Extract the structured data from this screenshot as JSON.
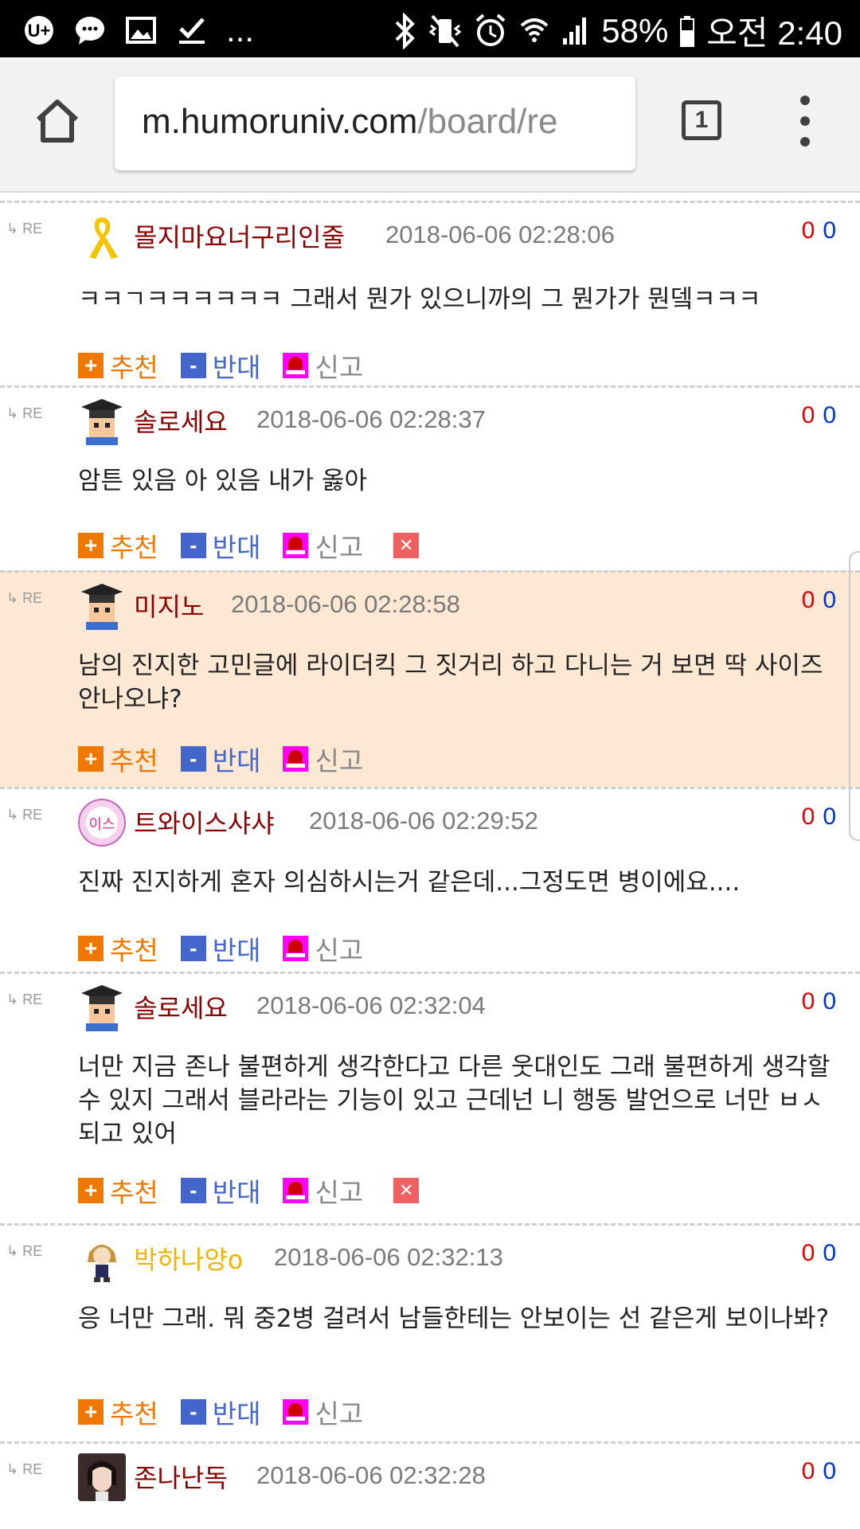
{
  "status_bar": {
    "icons_left": [
      "u-plus-icon",
      "talk-icon",
      "image-icon",
      "check-icon",
      "more-icon"
    ],
    "more_label": "...",
    "battery": "58%",
    "time": "오전 2:40"
  },
  "browser": {
    "url_host": "m.humoruniv.com",
    "url_path": "/board/re",
    "tab_count": "1"
  },
  "labels": {
    "re": "RE",
    "recommend": "추천",
    "oppose": "반대",
    "report": "신고",
    "plus": "+",
    "minus": "-",
    "delete": "✕"
  },
  "comments": [
    {
      "nick": "몰지마요너구리인줄",
      "date": "2018-06-06 02:28:06",
      "up": "0",
      "down": "0",
      "text": "ㅋㅋㄱㅋㅋㅋㅋㅋㅋ 그래서 뭔가 있으니까의 그 뭔가가 뭔뎈ㅋㅋㅋ",
      "avatar": "yellow-ribbon"
    },
    {
      "nick": "솔로세요",
      "date": "2018-06-06 02:28:37",
      "up": "0",
      "down": "0",
      "text": "암튼 있음 아 있음 내가 옳아",
      "avatar": "graduate",
      "deletable": true
    },
    {
      "nick": "미지노",
      "date": "2018-06-06 02:28:58",
      "up": "0",
      "down": "0",
      "text": "남의 진지한 고민글에 라이더킥 그 짓거리 하고 다니는 거 보면 딱 사이즈 안나오냐?",
      "avatar": "graduate",
      "highlighted": true
    },
    {
      "nick": "트와이스샤샤",
      "date": "2018-06-06 02:29:52",
      "up": "0",
      "down": "0",
      "text": "진짜 진지하게 혼자 의심하시는거 같은데...그정도면 병이에요....",
      "avatar": "twice"
    },
    {
      "nick": "솔로세요",
      "date": "2018-06-06 02:32:04",
      "up": "0",
      "down": "0",
      "text": "너만 지금 존나 불편하게 생각한다고 다른 웃대인도 그래 불편하게 생각할수 있지 그래서 블라라는 기능이 있고 근데넌 니 행동 발언으로 너만 ㅂㅅ되고 있어",
      "avatar": "graduate",
      "deletable": true
    },
    {
      "nick": "박하나양o",
      "date": "2018-06-06 02:32:13",
      "up": "0",
      "down": "0",
      "text": "응 너만 그래. 뭐 중2병 걸려서 남들한테는 안보이는 선 같은게 보이나봐?",
      "avatar": "anime"
    },
    {
      "nick": "존나난독",
      "date": "2018-06-06 02:32:28",
      "up": "0",
      "down": "0",
      "text": "",
      "avatar": "photo"
    }
  ]
}
